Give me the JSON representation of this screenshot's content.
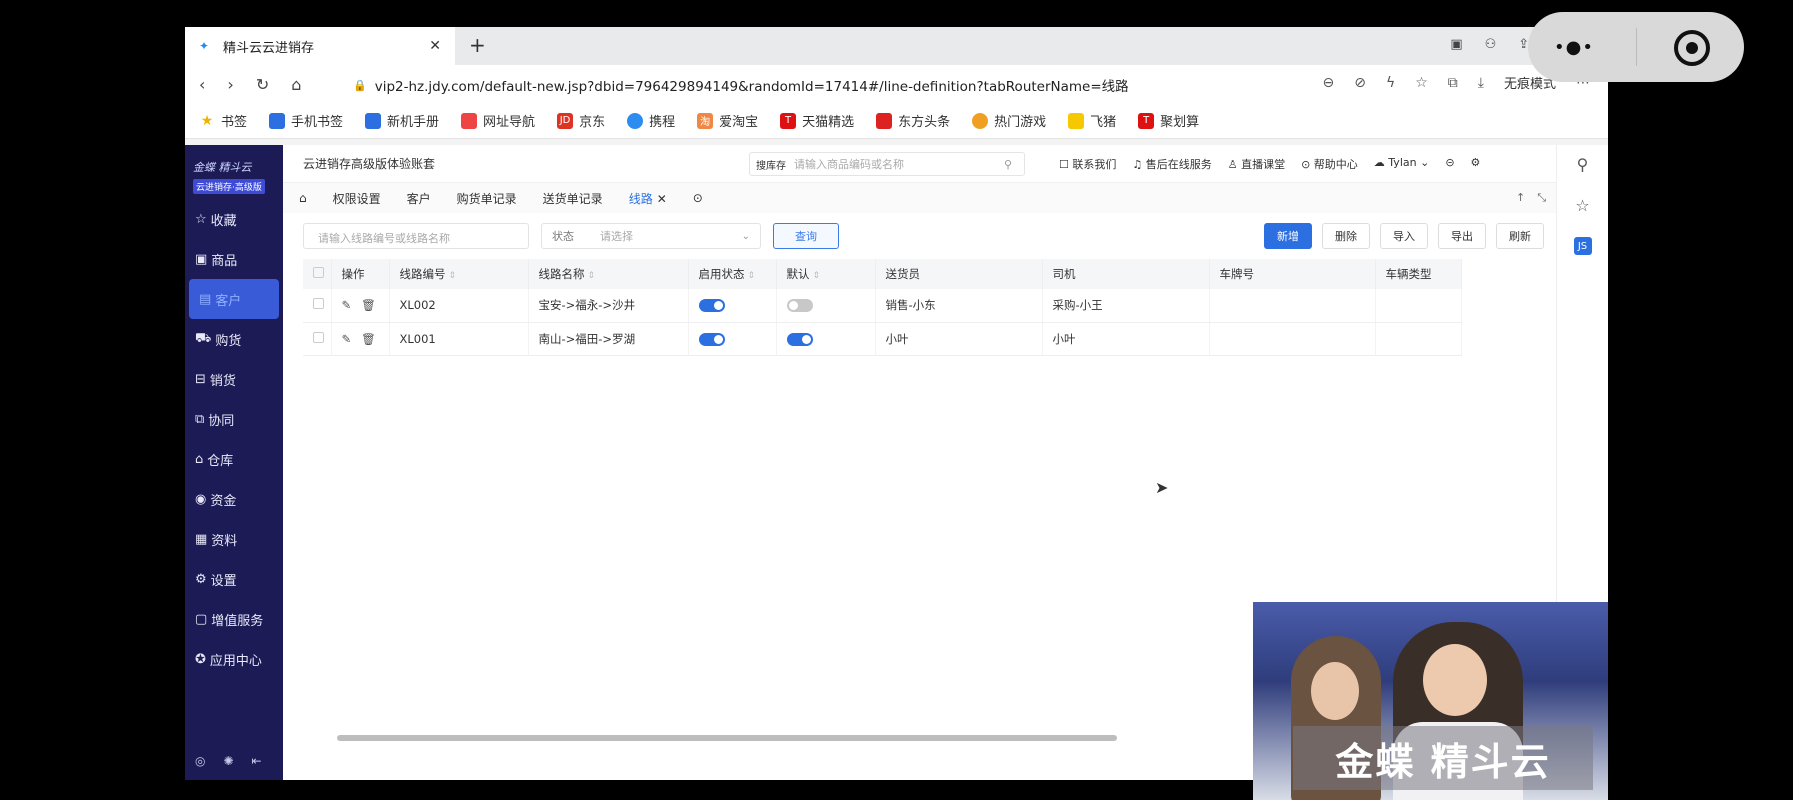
{
  "browser": {
    "tab_title": "精斗云云进销存",
    "tab_close": "✕",
    "new_tab": "+",
    "url": "vip2-hz.jdy.com/default-new.jsp?dbid=796429894149&randomId=17414#/line-definition?tabRouterName=线路",
    "mode_label": "无痕模式",
    "bookmarks": [
      "书签",
      "手机书签",
      "新机手册",
      "网址导航",
      "京东",
      "携程",
      "爱淘宝",
      "天猫精选",
      "东方头条",
      "热门游戏",
      "飞猪",
      "聚划算"
    ]
  },
  "sidebar": {
    "logo": "金蝶 精斗云",
    "edition": "云进销存·高级版",
    "items": [
      "收藏",
      "商品",
      "客户",
      "购货",
      "销货",
      "协同",
      "仓库",
      "资金",
      "资料",
      "设置",
      "增值服务",
      "应用中心"
    ],
    "active_index": 2
  },
  "topnav": {
    "account": "云进销存高级版体验账套",
    "search_tag": "搜库存",
    "search_placeholder": "请输入商品编码或名称",
    "links": [
      "联系我们",
      "售后在线服务",
      "直播课堂",
      "帮助中心",
      "Tylan"
    ]
  },
  "page_tabs": [
    "权限设置",
    "客户",
    "购货单记录",
    "送货单记录",
    "线路"
  ],
  "filters": {
    "code_placeholder": "请输入线路编号或线路名称",
    "status_label": "状态",
    "status_placeholder": "请选择",
    "query": "查询"
  },
  "actions": [
    "新增",
    "删除",
    "导入",
    "导出",
    "刷新"
  ],
  "table": {
    "columns": [
      "操作",
      "线路编号",
      "线路名称",
      "启用状态",
      "默认",
      "送货员",
      "司机",
      "车牌号",
      "车辆类型"
    ],
    "rows": [
      {
        "code": "XL002",
        "name": "宝安->福永->沙井",
        "enabled": true,
        "default": false,
        "courier": "销售-小东",
        "driver": "采购-小王",
        "plate": "",
        "vehicle": ""
      },
      {
        "code": "XL001",
        "name": "南山->福田->罗湖",
        "enabled": true,
        "default": true,
        "courier": "小叶",
        "driver": "小叶",
        "plate": "",
        "vehicle": ""
      }
    ]
  },
  "video": {
    "brand": "金蝶 精斗云"
  }
}
